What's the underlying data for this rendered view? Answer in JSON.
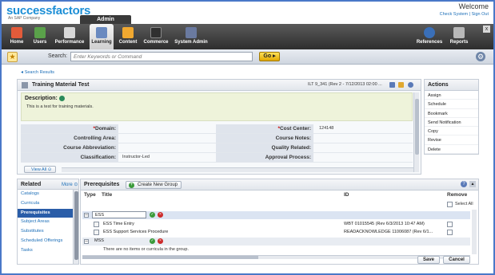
{
  "brand": {
    "logo": "successfactors",
    "sub": "An SAP Company",
    "admin_tab": "Admin"
  },
  "header": {
    "welcome": "Welcome",
    "links": "Check System | Sign Out"
  },
  "nav": {
    "items": [
      {
        "label": "Home",
        "icon": "home-icon",
        "color": "#e35b3a"
      },
      {
        "label": "Users",
        "icon": "users-icon",
        "color": "#5aa14a"
      },
      {
        "label": "Performance",
        "icon": "performance-icon",
        "color": "#d8d8d8"
      },
      {
        "label": "Learning",
        "icon": "learning-icon",
        "color": "#6a8ac0"
      },
      {
        "label": "Content",
        "icon": "content-icon",
        "color": "#f0a830"
      },
      {
        "label": "Commerce",
        "icon": "commerce-icon",
        "color": "#303030"
      },
      {
        "label": "System Admin",
        "icon": "system-admin-icon",
        "color": "#6a7aa0"
      },
      {
        "label": "References",
        "icon": "references-icon",
        "color": "#3a6fb8"
      },
      {
        "label": "Reports",
        "icon": "reports-icon",
        "color": "#b8b8b8"
      }
    ],
    "close": "x"
  },
  "search": {
    "label": "Search:",
    "placeholder": "Enter Keywords or Command",
    "go": "Go ▸"
  },
  "breadcrumb": "Search Results",
  "main": {
    "title": "Training Material Test",
    "id_text": "ILT 9_341 (Rev 2 - 7/12/2013 02:00 ...",
    "description_label": "Description:",
    "description_text": "This is a test for training materials.",
    "fields": {
      "domain_label": "Domain:",
      "domain_value": "",
      "cost_center_label": "Cost Center:",
      "cost_center_value": "124148",
      "controlling_area_label": "Controlling Area:",
      "controlling_area_value": "",
      "course_notes_label": "Course Notes:",
      "course_notes_value": "",
      "course_abbreviation_label": "Course Abbreviation:",
      "course_abbreviation_value": "",
      "quality_related_label": "Quality Related:",
      "quality_related_value": "",
      "classification_label": "Classification:",
      "classification_value": "Instructor-Led",
      "approval_process_label": "Approval Process:",
      "approval_process_value": ""
    },
    "view_all": "View All"
  },
  "actions": {
    "title": "Actions",
    "items": [
      "Assign",
      "Schedule",
      "Bookmark",
      "Send Notification",
      "Copy",
      "Revise",
      "Delete"
    ]
  },
  "related": {
    "title": "Related",
    "more": "More",
    "items": [
      "Catalogs",
      "Curricula",
      "Prerequisites",
      "Subject Areas",
      "Substitutes",
      "Scheduled Offerings",
      "Tasks"
    ]
  },
  "prereq": {
    "title": "Prerequisites",
    "new_group": "Create New Group",
    "col_type": "Type",
    "col_title": "Title",
    "col_id": "ID",
    "col_remove": "Remove",
    "select_all": "Select All",
    "groups": [
      {
        "name": "ESS",
        "items": [
          {
            "title": "ESS Time Entry",
            "id": "WBT 01015545 (Rev 6/3/2013 10:47 AM)"
          },
          {
            "title": "ESS Support Services Procedure",
            "id": "READACKNOWLEDGE 11006087 (Rev 6/1..."
          }
        ]
      },
      {
        "name": "MSS",
        "empty": "There are no items or curricula in the group."
      }
    ],
    "save": "Save",
    "cancel": "Cancel"
  }
}
